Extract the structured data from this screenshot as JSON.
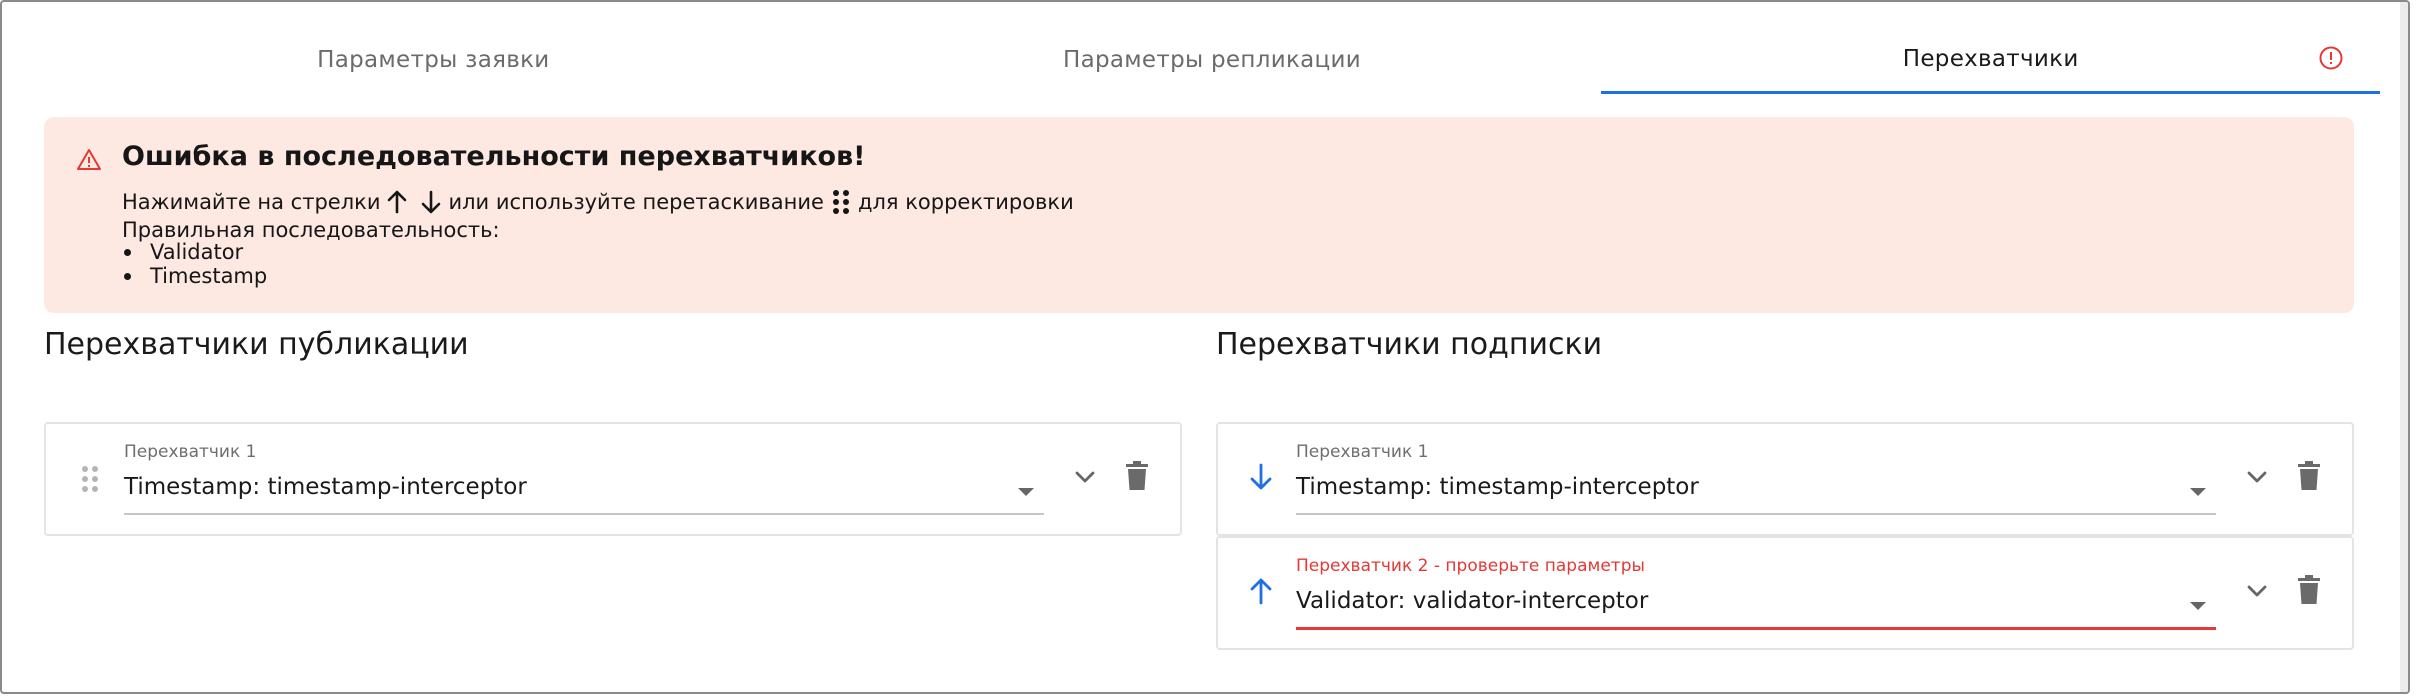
{
  "tabs": [
    {
      "label": "Параметры заявки",
      "active": false
    },
    {
      "label": "Параметры репликации",
      "active": false
    },
    {
      "label": "Перехватчики",
      "active": true,
      "has_warning": true
    }
  ],
  "colors": {
    "accent": "#1f6fe5",
    "error": "#e53935",
    "alert_bg": "#fde8e2"
  },
  "alert": {
    "icon": "warning-triangle-icon",
    "title": "Ошибка в последовательности перехватчиков!",
    "line_part1": "Нажимайте на стрелки",
    "line_part2": "или используйте перетаскивание",
    "line_part3": "для корректировки",
    "sub": "Правильная последовательность:",
    "sequence": [
      "Validator",
      "Timestamp"
    ]
  },
  "publication": {
    "title": "Перехватчики публикации",
    "items": [
      {
        "label": "Перехватчик 1",
        "value": "Timestamp: timestamp-interceptor",
        "error": false
      }
    ]
  },
  "subscription": {
    "title": "Перехватчики подписки",
    "items": [
      {
        "label": "Перехватчик 1",
        "value": "Timestamp: timestamp-interceptor",
        "error": false,
        "move_icon": "arrow-down-icon"
      },
      {
        "label": "Перехватчик 2 - проверьте параметры",
        "value": "Validator: validator-interceptor",
        "error": true,
        "move_icon": "arrow-up-icon"
      }
    ]
  }
}
